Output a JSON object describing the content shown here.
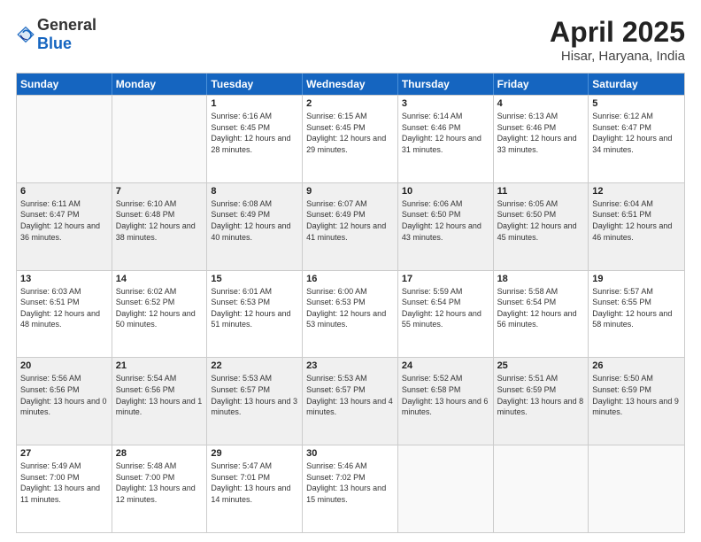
{
  "header": {
    "logo_general": "General",
    "logo_blue": "Blue",
    "title": "April 2025",
    "subtitle": "Hisar, Haryana, India"
  },
  "days_of_week": [
    "Sunday",
    "Monday",
    "Tuesday",
    "Wednesday",
    "Thursday",
    "Friday",
    "Saturday"
  ],
  "rows": [
    [
      {
        "day": "",
        "info": "",
        "empty": true
      },
      {
        "day": "",
        "info": "",
        "empty": true
      },
      {
        "day": "1",
        "info": "Sunrise: 6:16 AM\nSunset: 6:45 PM\nDaylight: 12 hours and 28 minutes."
      },
      {
        "day": "2",
        "info": "Sunrise: 6:15 AM\nSunset: 6:45 PM\nDaylight: 12 hours and 29 minutes."
      },
      {
        "day": "3",
        "info": "Sunrise: 6:14 AM\nSunset: 6:46 PM\nDaylight: 12 hours and 31 minutes."
      },
      {
        "day": "4",
        "info": "Sunrise: 6:13 AM\nSunset: 6:46 PM\nDaylight: 12 hours and 33 minutes."
      },
      {
        "day": "5",
        "info": "Sunrise: 6:12 AM\nSunset: 6:47 PM\nDaylight: 12 hours and 34 minutes."
      }
    ],
    [
      {
        "day": "6",
        "info": "Sunrise: 6:11 AM\nSunset: 6:47 PM\nDaylight: 12 hours and 36 minutes."
      },
      {
        "day": "7",
        "info": "Sunrise: 6:10 AM\nSunset: 6:48 PM\nDaylight: 12 hours and 38 minutes."
      },
      {
        "day": "8",
        "info": "Sunrise: 6:08 AM\nSunset: 6:49 PM\nDaylight: 12 hours and 40 minutes."
      },
      {
        "day": "9",
        "info": "Sunrise: 6:07 AM\nSunset: 6:49 PM\nDaylight: 12 hours and 41 minutes."
      },
      {
        "day": "10",
        "info": "Sunrise: 6:06 AM\nSunset: 6:50 PM\nDaylight: 12 hours and 43 minutes."
      },
      {
        "day": "11",
        "info": "Sunrise: 6:05 AM\nSunset: 6:50 PM\nDaylight: 12 hours and 45 minutes."
      },
      {
        "day": "12",
        "info": "Sunrise: 6:04 AM\nSunset: 6:51 PM\nDaylight: 12 hours and 46 minutes."
      }
    ],
    [
      {
        "day": "13",
        "info": "Sunrise: 6:03 AM\nSunset: 6:51 PM\nDaylight: 12 hours and 48 minutes."
      },
      {
        "day": "14",
        "info": "Sunrise: 6:02 AM\nSunset: 6:52 PM\nDaylight: 12 hours and 50 minutes."
      },
      {
        "day": "15",
        "info": "Sunrise: 6:01 AM\nSunset: 6:53 PM\nDaylight: 12 hours and 51 minutes."
      },
      {
        "day": "16",
        "info": "Sunrise: 6:00 AM\nSunset: 6:53 PM\nDaylight: 12 hours and 53 minutes."
      },
      {
        "day": "17",
        "info": "Sunrise: 5:59 AM\nSunset: 6:54 PM\nDaylight: 12 hours and 55 minutes."
      },
      {
        "day": "18",
        "info": "Sunrise: 5:58 AM\nSunset: 6:54 PM\nDaylight: 12 hours and 56 minutes."
      },
      {
        "day": "19",
        "info": "Sunrise: 5:57 AM\nSunset: 6:55 PM\nDaylight: 12 hours and 58 minutes."
      }
    ],
    [
      {
        "day": "20",
        "info": "Sunrise: 5:56 AM\nSunset: 6:56 PM\nDaylight: 13 hours and 0 minutes."
      },
      {
        "day": "21",
        "info": "Sunrise: 5:54 AM\nSunset: 6:56 PM\nDaylight: 13 hours and 1 minute."
      },
      {
        "day": "22",
        "info": "Sunrise: 5:53 AM\nSunset: 6:57 PM\nDaylight: 13 hours and 3 minutes."
      },
      {
        "day": "23",
        "info": "Sunrise: 5:53 AM\nSunset: 6:57 PM\nDaylight: 13 hours and 4 minutes."
      },
      {
        "day": "24",
        "info": "Sunrise: 5:52 AM\nSunset: 6:58 PM\nDaylight: 13 hours and 6 minutes."
      },
      {
        "day": "25",
        "info": "Sunrise: 5:51 AM\nSunset: 6:59 PM\nDaylight: 13 hours and 8 minutes."
      },
      {
        "day": "26",
        "info": "Sunrise: 5:50 AM\nSunset: 6:59 PM\nDaylight: 13 hours and 9 minutes."
      }
    ],
    [
      {
        "day": "27",
        "info": "Sunrise: 5:49 AM\nSunset: 7:00 PM\nDaylight: 13 hours and 11 minutes."
      },
      {
        "day": "28",
        "info": "Sunrise: 5:48 AM\nSunset: 7:00 PM\nDaylight: 13 hours and 12 minutes."
      },
      {
        "day": "29",
        "info": "Sunrise: 5:47 AM\nSunset: 7:01 PM\nDaylight: 13 hours and 14 minutes."
      },
      {
        "day": "30",
        "info": "Sunrise: 5:46 AM\nSunset: 7:02 PM\nDaylight: 13 hours and 15 minutes."
      },
      {
        "day": "",
        "info": "",
        "empty": true
      },
      {
        "day": "",
        "info": "",
        "empty": true
      },
      {
        "day": "",
        "info": "",
        "empty": true
      }
    ]
  ]
}
